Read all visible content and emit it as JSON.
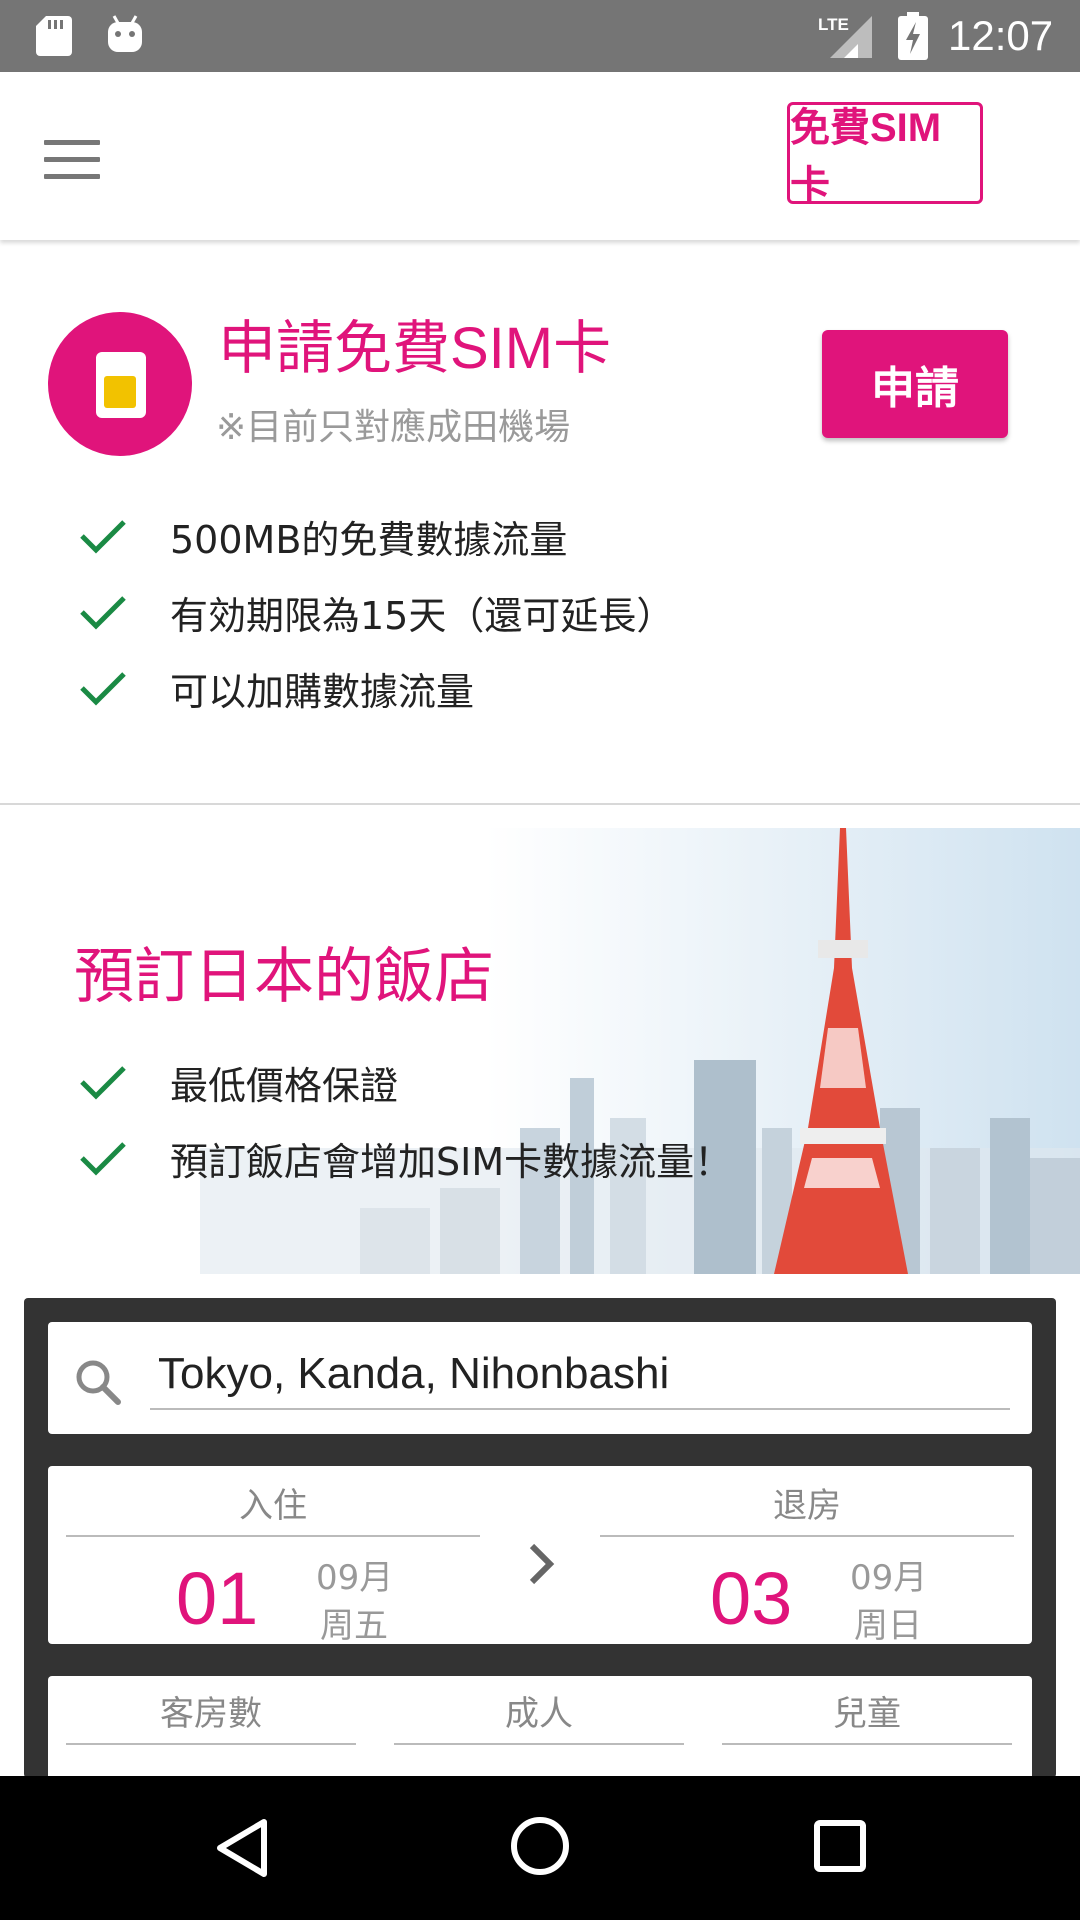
{
  "status_bar": {
    "time": "12:07",
    "icons": [
      "sd-card-icon",
      "android-icon",
      "lte-signal-icon",
      "battery-charging-icon"
    ],
    "lte_label": "LTE"
  },
  "header": {
    "menu_icon": "menu-icon",
    "free_sim_button": "免費SIM卡"
  },
  "sim_section": {
    "title": "申請免費SIM卡",
    "note": "※目前只對應成田機場",
    "apply_button": "申請",
    "features": [
      "500MB的免費數據流量",
      "有効期限為15天（還可延長）",
      "可以加購數據流量"
    ]
  },
  "hotel_section": {
    "title": "預訂日本的飯店",
    "features": [
      "最低價格保證",
      "預訂飯店會增加SIM卡數據流量！"
    ]
  },
  "search": {
    "destination_value": "Tokyo, Kanda, Nihonbashi",
    "checkin": {
      "label": "入住",
      "day": "01",
      "month": "09月",
      "weekday": "周五"
    },
    "checkout": {
      "label": "退房",
      "day": "03",
      "month": "09月",
      "weekday": "周日"
    },
    "guest_labels": {
      "rooms": "客房數",
      "adults": "成人",
      "children": "兒童"
    }
  },
  "colors": {
    "accent": "#e0147b",
    "check": "#1a8a44",
    "status_bar": "#757575",
    "panel": "#333333"
  }
}
